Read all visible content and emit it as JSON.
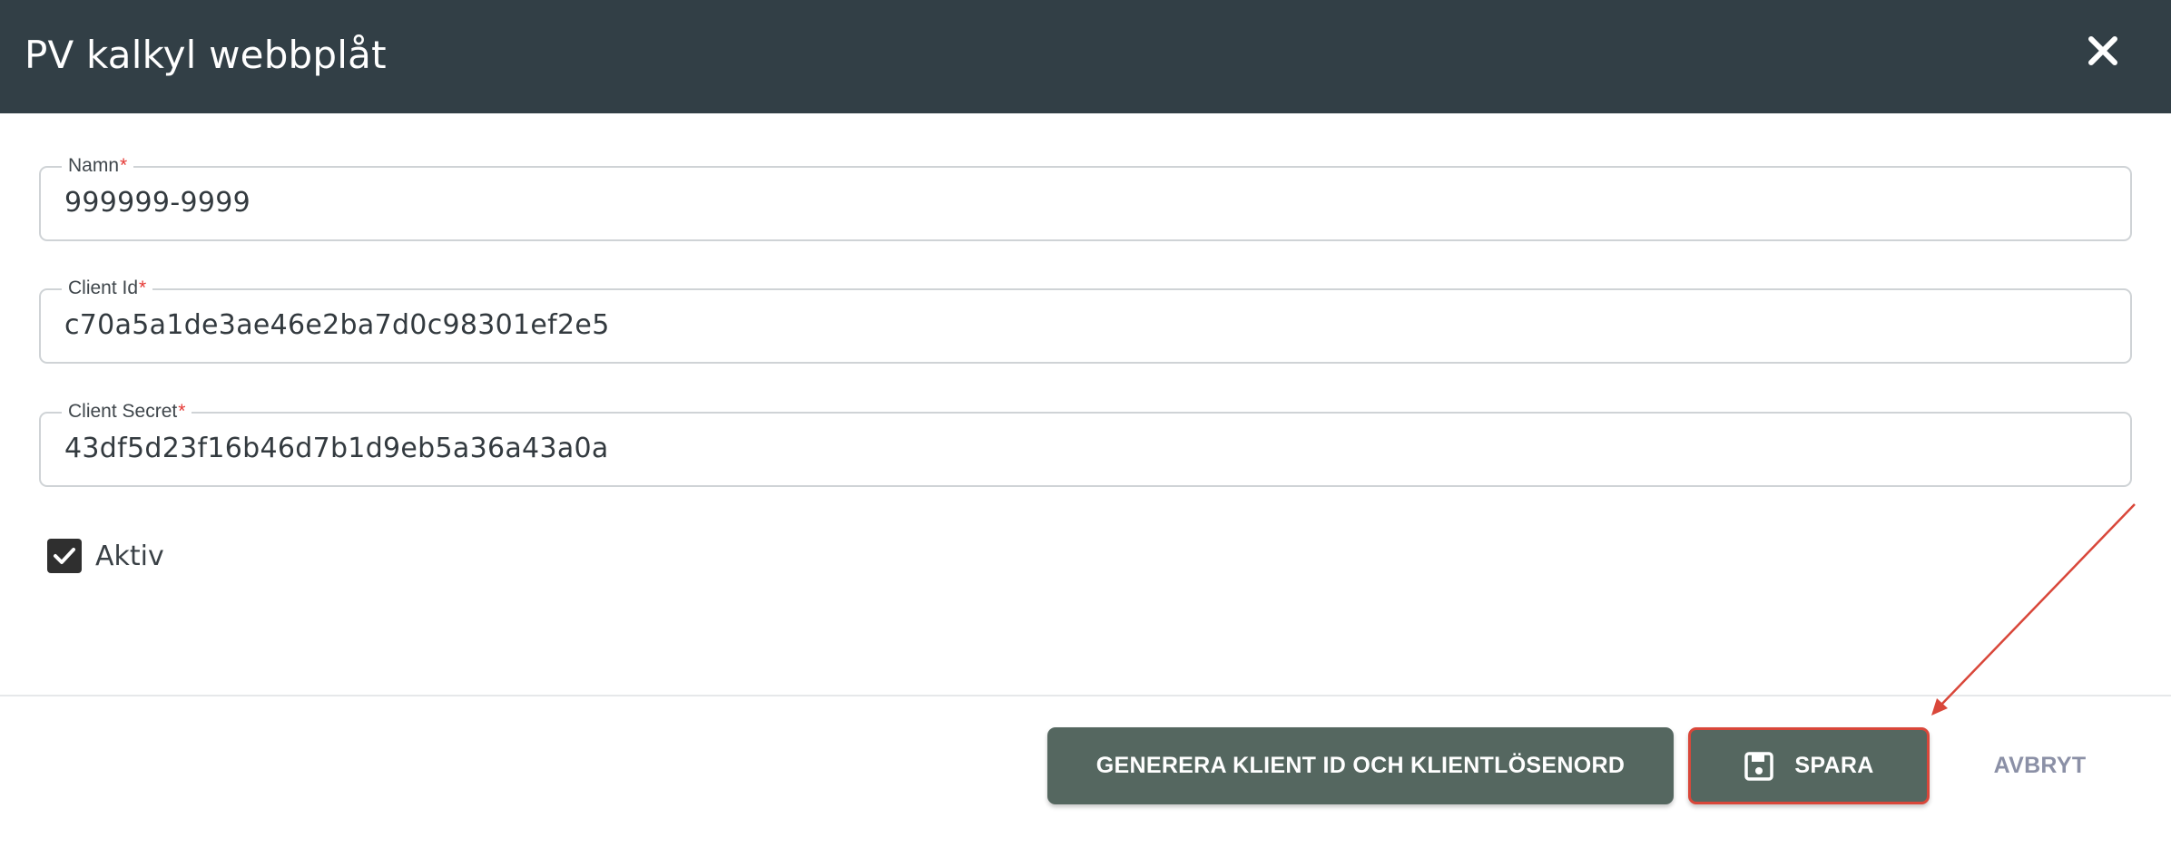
{
  "dialog": {
    "title": "PV kalkyl webbplåt",
    "close_icon": "close-icon"
  },
  "form": {
    "fields": [
      {
        "label": "Namn",
        "required_mark": "*",
        "value": "999999-9999"
      },
      {
        "label": "Client Id",
        "required_mark": "*",
        "value": "c70a5a1de3ae46e2ba7d0c98301ef2e5"
      },
      {
        "label": "Client Secret",
        "required_mark": "*",
        "value": "43df5d23f16b46d7b1d9eb5a36a43a0a"
      }
    ],
    "active": {
      "label": "Aktiv",
      "checked": true
    }
  },
  "actions": {
    "generate_label": "GENERERA KLIENT ID OCH KLIENTLÖSENORD",
    "save_label": "SPARA",
    "save_icon": "floppy-disk-icon",
    "cancel_label": "AVBRYT"
  },
  "colors": {
    "header_bg": "#323f46",
    "button_bg": "#556760",
    "required": "#e53935",
    "annotation": "#d9473a",
    "cancel_text": "#8b90a6"
  }
}
